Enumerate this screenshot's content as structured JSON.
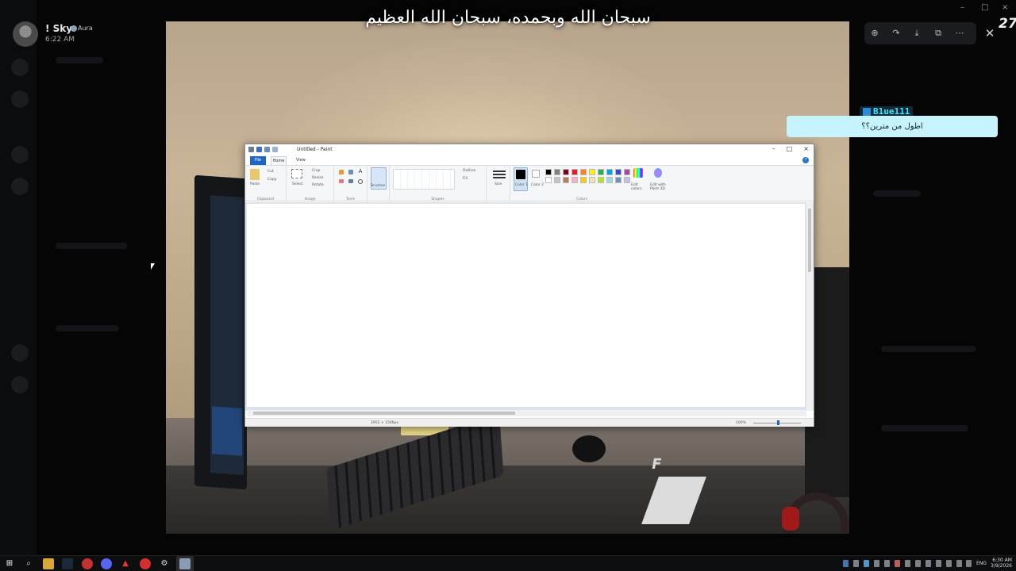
{
  "header": {
    "username": "! Sky",
    "badge": "Aura",
    "time": "6:22 AM"
  },
  "caption": "سبحان الله وبحمده، سبحان الله العظيم",
  "corner_number": "27",
  "viewer_toolbar": {
    "icons": [
      "zoom-in-icon",
      "forward-icon",
      "download-icon",
      "open-external-icon",
      "more-icon"
    ],
    "close_icon": "close-icon"
  },
  "chat": {
    "name": "B1ue111",
    "message": "اطول من مترين؟؟"
  },
  "paint": {
    "title": "Untitled - Paint",
    "tabs": {
      "file": "File",
      "home": "Home",
      "view": "View"
    },
    "clipboard": {
      "paste": "Paste",
      "cut": "Cut",
      "copy": "Copy",
      "label": "Clipboard"
    },
    "image": {
      "select": "Select",
      "crop": "Crop",
      "resize": "Resize",
      "rotate": "Rotate",
      "label": "Image"
    },
    "tools": {
      "label": "Tools"
    },
    "brushes": "Brushes",
    "shapes": {
      "outline": "Outline",
      "fill": "Fill",
      "label": "Shapes"
    },
    "size": "Size",
    "color1": "Color 1",
    "color2": "Color 2",
    "colors_label": "Colors",
    "edit_colors": "Edit colors",
    "edit_paint3d": "Edit with Paint 3D",
    "palette": [
      "#000000",
      "#7f7f7f",
      "#880015",
      "#ed1c24",
      "#ff7f27",
      "#fff200",
      "#22b14c",
      "#00a2e8",
      "#3f48cc",
      "#a349a4",
      "#ffffff",
      "#c3c3c3",
      "#b97a57",
      "#ffaec9",
      "#ffc90e",
      "#efe4b0",
      "#b5e61d",
      "#99d9ea",
      "#7092be",
      "#c8bfe7"
    ],
    "status_size": "2952 × 1506px",
    "zoom": "100%"
  },
  "taskbar": {
    "lang": "ENG",
    "time": "6:30 AM",
    "date": "3/9/2026"
  }
}
